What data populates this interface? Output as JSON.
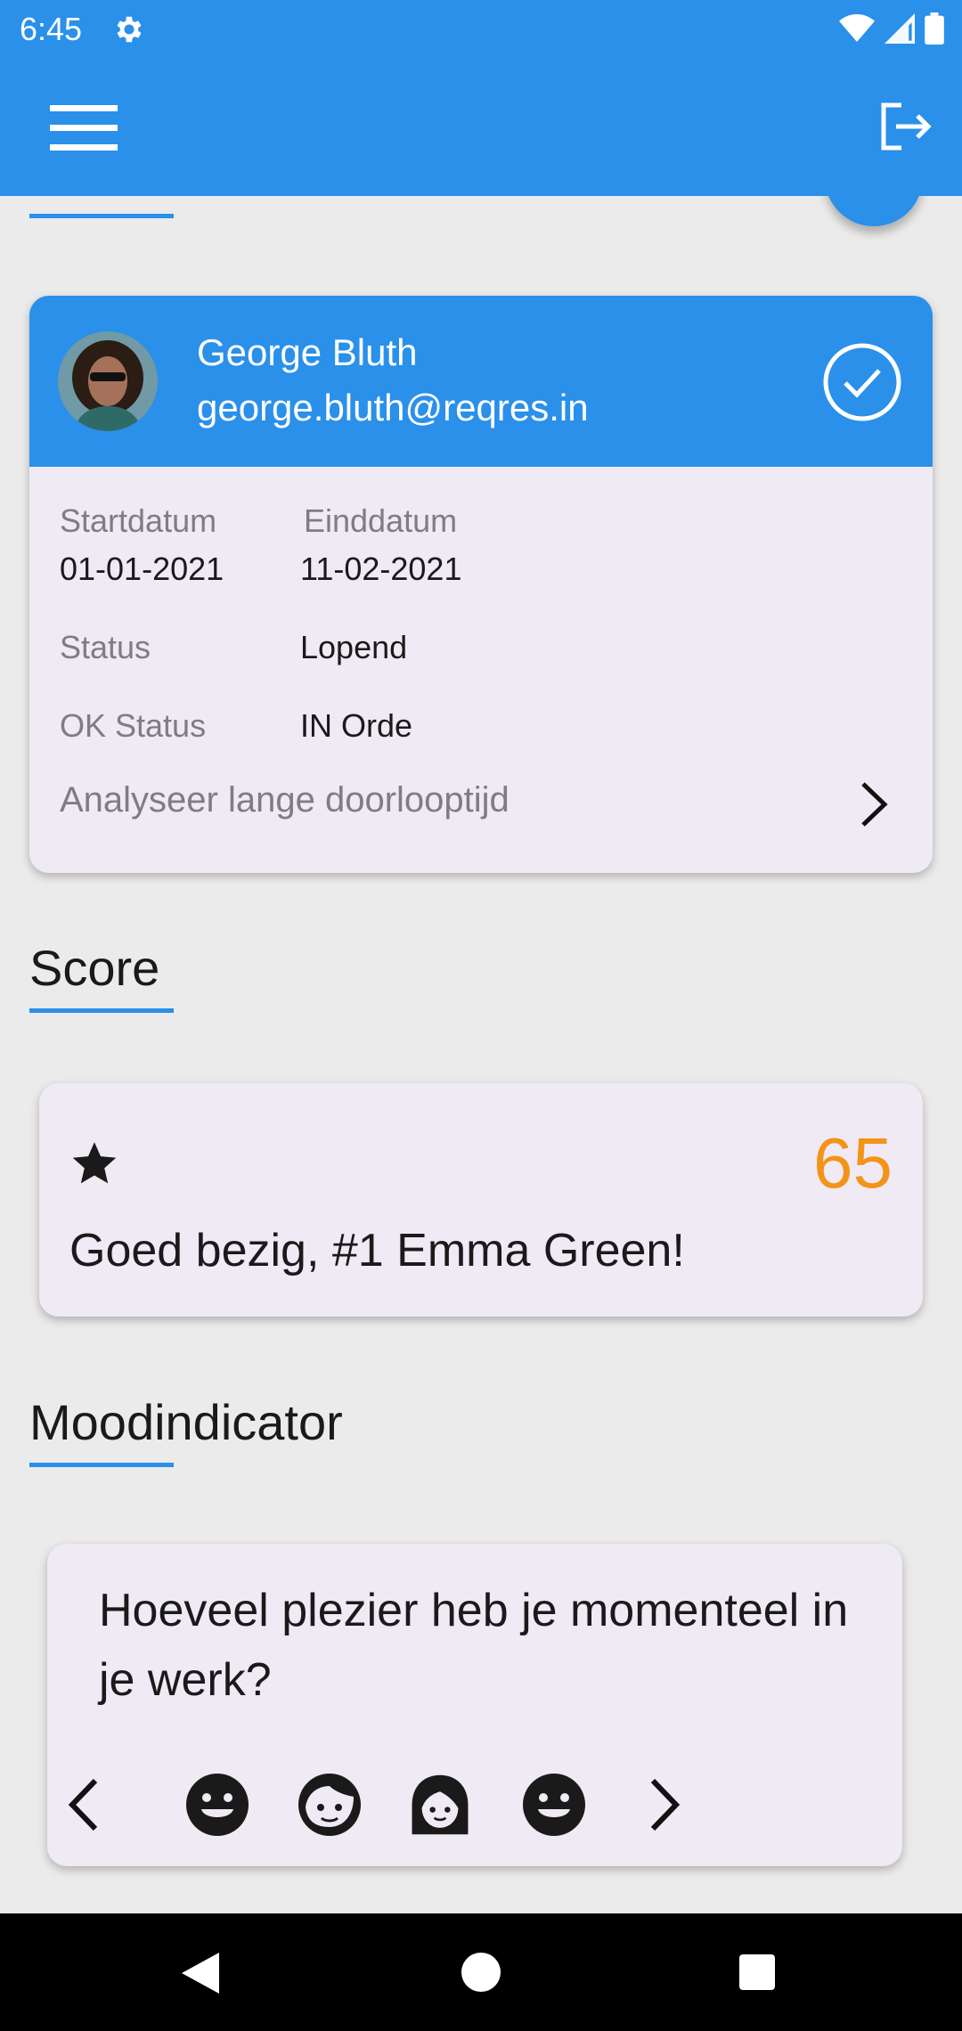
{
  "status_bar": {
    "time": "6:45"
  },
  "user_card": {
    "name": "George Bluth",
    "email": "george.bluth@reqres.in",
    "start_label": "Startdatum",
    "start_value": "01-01-2021",
    "end_label": "Einddatum",
    "end_value": "11-02-2021",
    "status_label": "Status",
    "status_value": "Lopend",
    "ok_label": "OK Status",
    "ok_value": "IN Orde",
    "analyse_label": "Analyseer lange doorlooptijd"
  },
  "score_section": {
    "title": "Score",
    "value": "65",
    "message": "Goed bezig, #1 Emma Green!"
  },
  "mood_section": {
    "title": "Moodindicator",
    "question": "Hoeveel plezier heb je momenteel in je werk?",
    "faces": [
      "smiling-face-icon",
      "girl-face-icon",
      "woman-face-icon",
      "smiling-face-icon"
    ]
  },
  "colors": {
    "primary": "#2a90ea",
    "accent": "#f39419",
    "card_bg": "#efeaf4",
    "page_bg": "#ebebeb"
  }
}
